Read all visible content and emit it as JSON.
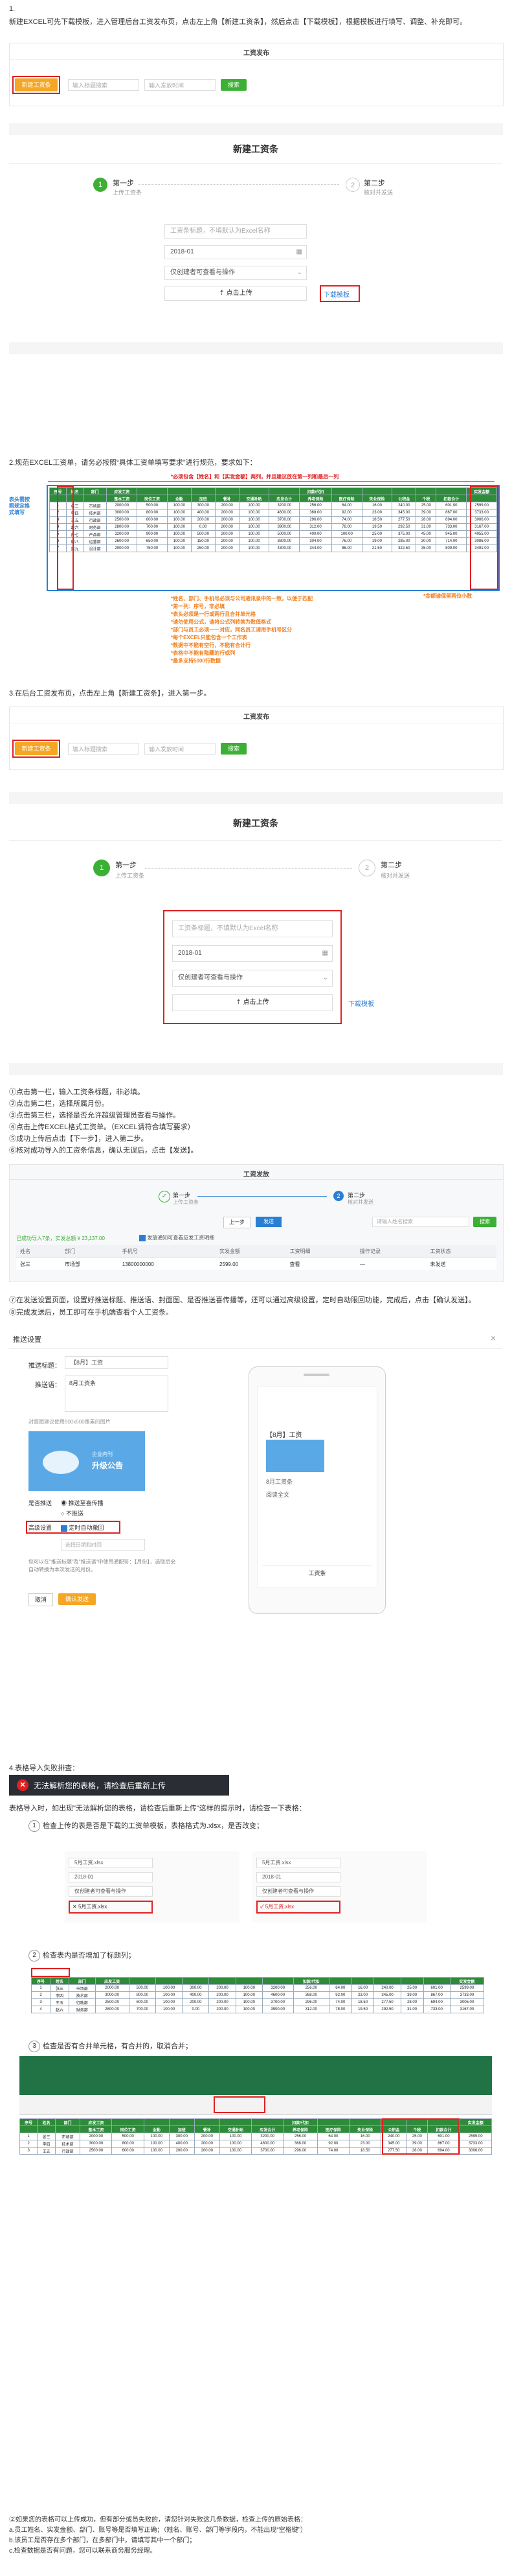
{
  "sec1": {
    "num": "1.",
    "intro": "新建EXCEL可先下载模板，进入管理后台工资发布页，点击左上角【新建工资条】，然后点击【下载模板】，根据模板进行填写、调整、补充即可。",
    "list_header": "工资发布",
    "new_btn": "新建工资条",
    "search_ph": "输入标题搜索",
    "date_ph": "输入发放时间",
    "search_btn": "搜索",
    "new_title": "新建工资条",
    "step1_title": "第一步",
    "step1_sub": "上传工资条",
    "step2_title": "第二步",
    "step2_sub": "核对并发送",
    "salary_title_ph": "工资条标题，不填默认为Excel名称",
    "month": "2018-01",
    "visibility": "仅创建者可查看与操作",
    "upload": "点击上传",
    "download_tpl": "下载模板"
  },
  "sec2": {
    "text": "2.规范EXCEL工资单，请务必按照“具体工资单填写要求”进行规范，要求如下：",
    "ann_top": "*必须包含【姓名】和【实发金额】两列，并且建议放在第一列和最后一列",
    "ann_left": "表头需按照规定格式填写",
    "ann_right": "*金额请保留两位小数",
    "notes": [
      "*姓名、部门、手机号必须与公司通讯录中的一致，以便于匹配",
      "*第一列：序号，非必填",
      "*表头必须是一行或两行且合并单元格",
      "*请勿使用公式，请将公式列转换为数值格式",
      "*部门与员工必须一一对应，同名员工请用手机号区分",
      "*每个EXCEL只能包含一个工作表",
      "*数据中不能有空行，不能有合计行",
      "*表格中不能有隐藏的行或列",
      "*最多支持5000行数据"
    ],
    "header_row1": [
      "序号",
      "姓名",
      "部门",
      "应发工资",
      "",
      "",
      "",
      "",
      "",
      "",
      "扣款/代扣",
      "",
      "",
      "",
      "",
      "",
      "实发金额"
    ],
    "header_row2": [
      "",
      "",
      "",
      "基本工资",
      "岗位工资",
      "全勤",
      "加班",
      "餐补",
      "交通补贴",
      "应发合计",
      "养老保险",
      "医疗保险",
      "失业保险",
      "公积金",
      "个税",
      "扣款合计",
      ""
    ],
    "rows": [
      [
        "1",
        "张三",
        "市场部",
        "2000.00",
        "500.00",
        "100.00",
        "300.00",
        "200.00",
        "100.00",
        "3200.00",
        "256.00",
        "64.00",
        "16.00",
        "240.00",
        "25.00",
        "601.00",
        "2599.00"
      ],
      [
        "2",
        "李四",
        "技术部",
        "3000.00",
        "800.00",
        "100.00",
        "400.00",
        "200.00",
        "100.00",
        "4600.00",
        "368.00",
        "92.00",
        "23.00",
        "345.00",
        "39.00",
        "867.00",
        "3733.00"
      ],
      [
        "3",
        "王五",
        "行政部",
        "2500.00",
        "600.00",
        "100.00",
        "200.00",
        "200.00",
        "100.00",
        "3700.00",
        "296.00",
        "74.00",
        "18.50",
        "277.50",
        "28.00",
        "694.00",
        "3006.00"
      ],
      [
        "4",
        "赵六",
        "财务部",
        "2800.00",
        "700.00",
        "100.00",
        "0.00",
        "200.00",
        "100.00",
        "3900.00",
        "312.00",
        "78.00",
        "19.50",
        "292.50",
        "31.00",
        "733.00",
        "3167.00"
      ],
      [
        "5",
        "孙七",
        "产品部",
        "3200.00",
        "900.00",
        "100.00",
        "500.00",
        "200.00",
        "100.00",
        "5000.00",
        "400.00",
        "100.00",
        "25.00",
        "375.00",
        "45.00",
        "945.00",
        "4055.00"
      ],
      [
        "6",
        "周八",
        "运营部",
        "2600.00",
        "650.00",
        "100.00",
        "150.00",
        "200.00",
        "100.00",
        "3800.00",
        "304.00",
        "76.00",
        "19.00",
        "285.00",
        "30.00",
        "714.00",
        "3086.00"
      ],
      [
        "7",
        "吴九",
        "设计部",
        "2900.00",
        "750.00",
        "100.00",
        "250.00",
        "200.00",
        "100.00",
        "4300.00",
        "344.00",
        "86.00",
        "21.50",
        "322.50",
        "35.00",
        "809.00",
        "3491.00"
      ]
    ]
  },
  "sec3": {
    "text": "3.在后台工资发布页，点击左上角【新建工资条】，进入第一步。",
    "steps": [
      "①点击第一栏，输入工资条标题，非必填。",
      "②点击第二栏，选择所属月份。",
      "③点击第三栏，选择是否允许超级管理员查看与操作。",
      "④点击上传EXCEL格式工资单。（EXCEL请符合填写要求）",
      "⑤成功上传后点击【下一步】，进入第二步。",
      "⑥核对成功导入的工资条信息，确认无误后，点击【发送】。"
    ]
  },
  "sec3b": {
    "header": "工资发放",
    "step1_title": "第一步",
    "step1_sub": "上传工资条",
    "step2_title": "第二步",
    "step2_sub": "核对并发送",
    "prev": "上一步",
    "send": "发送",
    "search_ph": "请输入姓名搜索",
    "search_btn": "搜索",
    "summary": "已成功导入7条，实发总额 ¥ 23,137.00",
    "notify_label": "发放通知可查看应发工资明细",
    "cols": [
      "姓名",
      "部门",
      "手机号",
      "实发金额",
      "工资明细",
      "操作记录",
      "工资状态"
    ],
    "row": [
      "张三",
      "市场部",
      "13800000000",
      "2599.00",
      "查看",
      "—",
      "未发送"
    ]
  },
  "sec4": {
    "steps": [
      "⑦在发送设置页面，设置好推送标题、推送语、封面图、是否推送喜传播等，还可以通过高级设置，定时自动限回功能，完成后，点击【确认发送】。",
      "⑧完成发送后，员工即可在手机端查看个人工资条。"
    ],
    "dialog_title": "推送设置",
    "label_title": "推送标题：",
    "title_val": "【8月】工资",
    "label_msg": "推送语：",
    "msg_val": "8月工资条",
    "cover_hint": "封面图建议使用900x500像素的图片",
    "cover_caption": "企业内刊",
    "cover_big": "升级公告",
    "label_push": "是否推送",
    "push_opt1": "推送至喜传播",
    "push_opt2": "不推送",
    "label_adv": "高级设置",
    "adv_opt": "定时自动撤回",
    "time_ph": "选择日期和时间",
    "note": "您可以在\"推送标题\"及\"推送语\"中使用通配符：【月份】，选取后会自动转换为本次发送的月份。",
    "cancel": "取消",
    "confirm": "确认发送",
    "phone_title": "【8月】工资",
    "phone_sub": "8月工资条",
    "phone_btn": "工资条",
    "phone_read": "阅读全文"
  },
  "sec5": {
    "text": "4.表格导入失败排查：",
    "error": "无法解析您的表格，请检查后重新上传",
    "desc": "表格导入时，如出现\"无法解析您的表格，请检查后重新上传\"这样的提示时，请检查一下表格：",
    "check1": "检查上传的表是否是下载的工资单模板，表格格式为.xlsx，是否改变；",
    "file_bad": "5月工资.xlsx",
    "file_good": "5月工资.xlsx",
    "check2": "检查表内是否增加了标题列；",
    "check3": "检查是否有合并单元格，有合并的，取消合并；",
    "final": [
      "②如果您的表格可以上传成功，但有部分或员失败的，请您针对失败这几条数据，检查上传的原始表格：",
      "a.员工姓名、实发金额、部门、账号等是否填写正确；（姓名、账号、部门等字段内，不能出现“空格键”）",
      "b.该员工是否存在多个部门，在多部门中，请填写其中一个部门；",
      "c.检查数据是否有问题，您可以联系商务服务经理。"
    ]
  }
}
